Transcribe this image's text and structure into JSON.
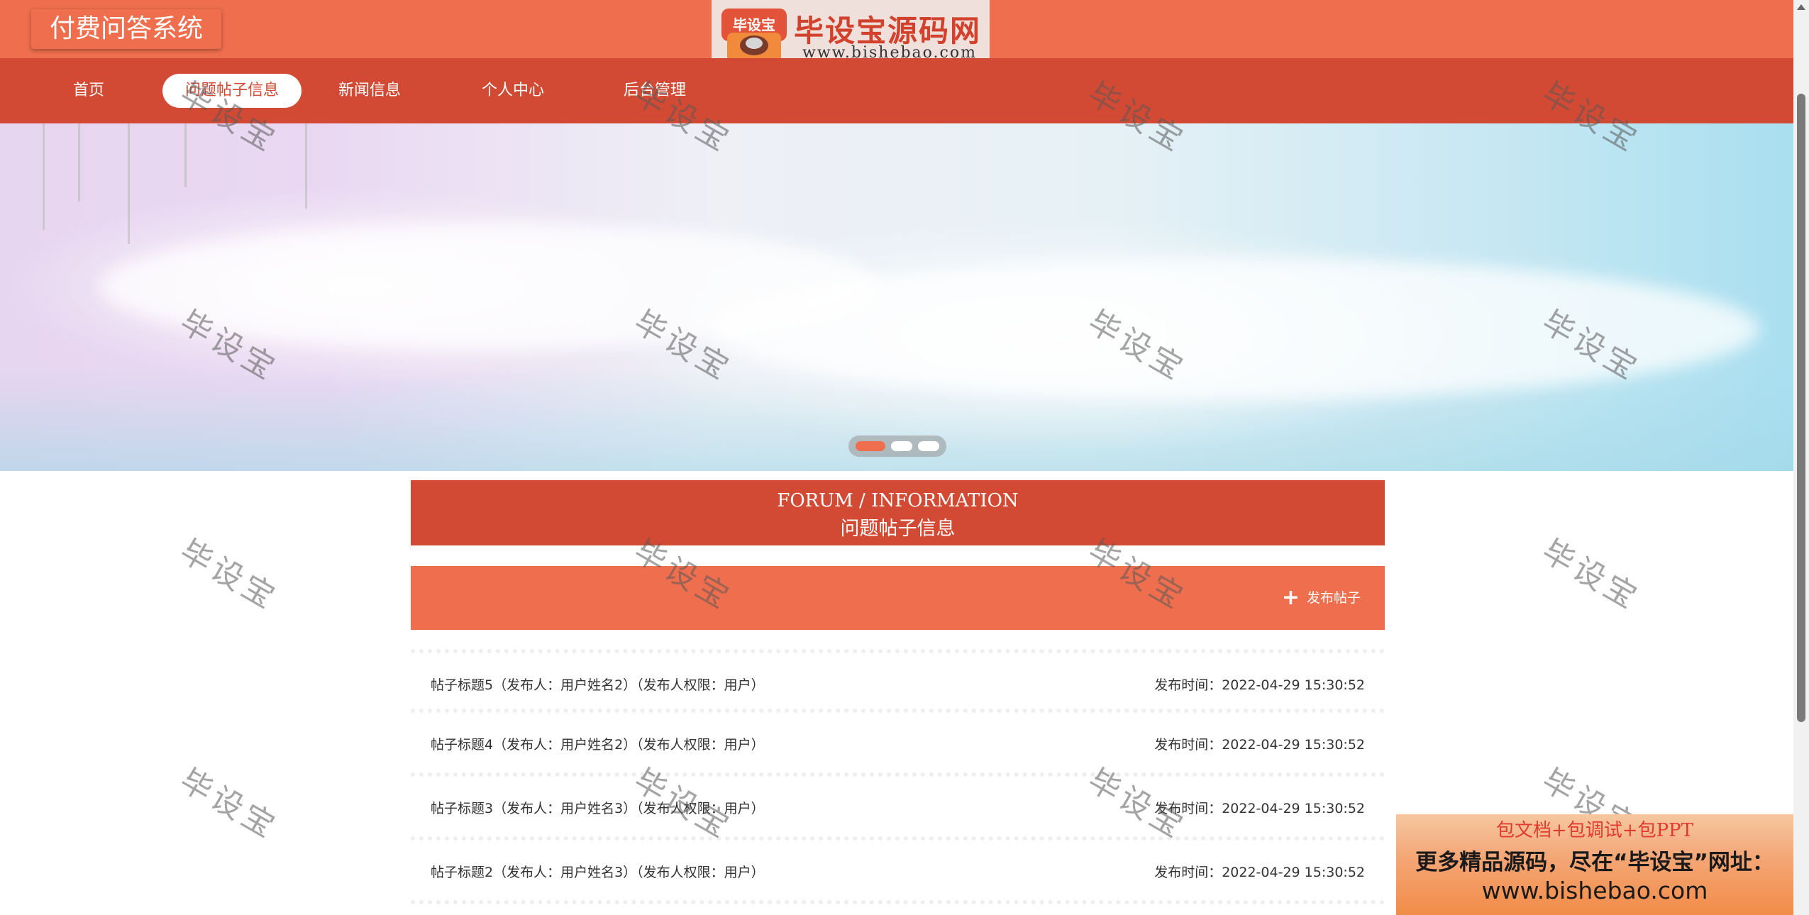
{
  "header": {
    "system_title": "付费问答系统",
    "logo_badge_text": "毕设宝",
    "logo_text": "毕设宝源码网",
    "logo_url": "www.bishebao.com"
  },
  "nav": {
    "items": [
      {
        "label": "首页",
        "active": false
      },
      {
        "label": "问题帖子信息",
        "active": true
      },
      {
        "label": "新闻信息",
        "active": false
      },
      {
        "label": "个人中心",
        "active": false
      },
      {
        "label": "后台管理",
        "active": false
      }
    ]
  },
  "carousel": {
    "slide_count": 3,
    "active_index": 0
  },
  "section": {
    "title_en": "FORUM / INFORMATION",
    "title_cn": "问题帖子信息"
  },
  "actions": {
    "publish_label": "发布帖子"
  },
  "posts": [
    {
      "title": "帖子标题5（发布人：用户姓名2）（发布人权限：用户）",
      "time": "发布时间：2022-04-29 15:30:52"
    },
    {
      "title": "帖子标题4（发布人：用户姓名2）（发布人权限：用户）",
      "time": "发布时间：2022-04-29 15:30:52"
    },
    {
      "title": "帖子标题3（发布人：用户姓名3）（发布人权限：用户）",
      "time": "发布时间：2022-04-29 15:30:52"
    },
    {
      "title": "帖子标题2（发布人：用户姓名3）（发布人权限：用户）",
      "time": "发布时间：2022-04-29 15:30:52"
    }
  ],
  "ad": {
    "line1": "包文档+包调试+包PPT",
    "line2": "更多精品源码，尽在“毕设宝”网址：",
    "line3": "www.bishebao.com"
  },
  "watermark": "毕设宝",
  "colors": {
    "accent": "#ee6e4e",
    "accent_dark": "#d24a33"
  }
}
